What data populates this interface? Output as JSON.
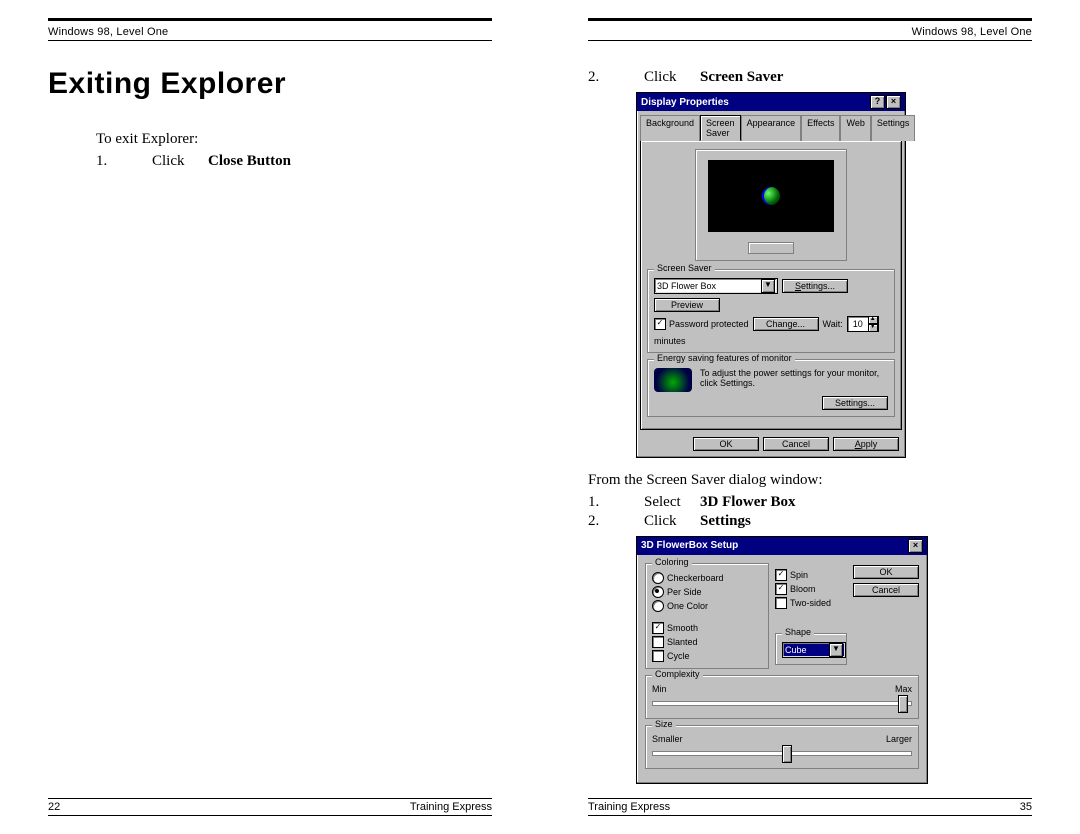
{
  "left": {
    "header": "Windows 98, Level One",
    "title": "Exiting Explorer",
    "intro": "To exit Explorer:",
    "step1_num": "1.",
    "step1_verb": "Click",
    "step1_target": "Close Button",
    "footer_page": "22",
    "footer_brand": "Training Express"
  },
  "right": {
    "header": "Windows 98, Level One",
    "top_step_num": "2.",
    "top_step_verb": "Click",
    "top_step_target": "Screen Saver",
    "dlg1": {
      "title": "Display Properties",
      "tabs": [
        "Background",
        "Screen Saver",
        "Appearance",
        "Effects",
        "Web",
        "Settings"
      ],
      "group_ss": "Screen Saver",
      "combo_value": "3D Flower Box",
      "btn_settings": "Settings...",
      "btn_preview": "Preview",
      "chk_pwd": "Password protected",
      "btn_change": "Change...",
      "wait_label": "Wait:",
      "wait_value": "10",
      "wait_unit": "minutes",
      "group_energy": "Energy saving features of monitor",
      "energy_text1": "To adjust the power settings for your monitor,",
      "energy_text2": "click Settings.",
      "btn_settings2": "Settings...",
      "btn_ok": "OK",
      "btn_cancel": "Cancel",
      "btn_apply": "Apply"
    },
    "mid_text": "From the Screen Saver dialog window:",
    "mid_step1_num": "1.",
    "mid_step1_verb": "Select",
    "mid_step1_target": "3D Flower Box",
    "mid_step2_num": "2.",
    "mid_step2_verb": "Click",
    "mid_step2_target": "Settings",
    "dlg2": {
      "title": "3D FlowerBox Setup",
      "group_color": "Coloring",
      "opt_checker": "Checkerboard",
      "opt_perside": "Per Side",
      "opt_onecolor": "One Color",
      "chk_smooth": "Smooth",
      "chk_slanted": "Slanted",
      "chk_cycle": "Cycle",
      "chk_spin": "Spin",
      "chk_bloom": "Bloom",
      "chk_twosided": "Two-sided",
      "btn_ok": "OK",
      "btn_cancel": "Cancel",
      "group_shape": "Shape",
      "shape_value": "Cube",
      "group_complex": "Complexity",
      "complex_min": "Min",
      "complex_max": "Max",
      "group_size": "Size",
      "size_min": "Smaller",
      "size_max": "Larger"
    },
    "footer_brand": "Training Express",
    "footer_page": "35"
  }
}
